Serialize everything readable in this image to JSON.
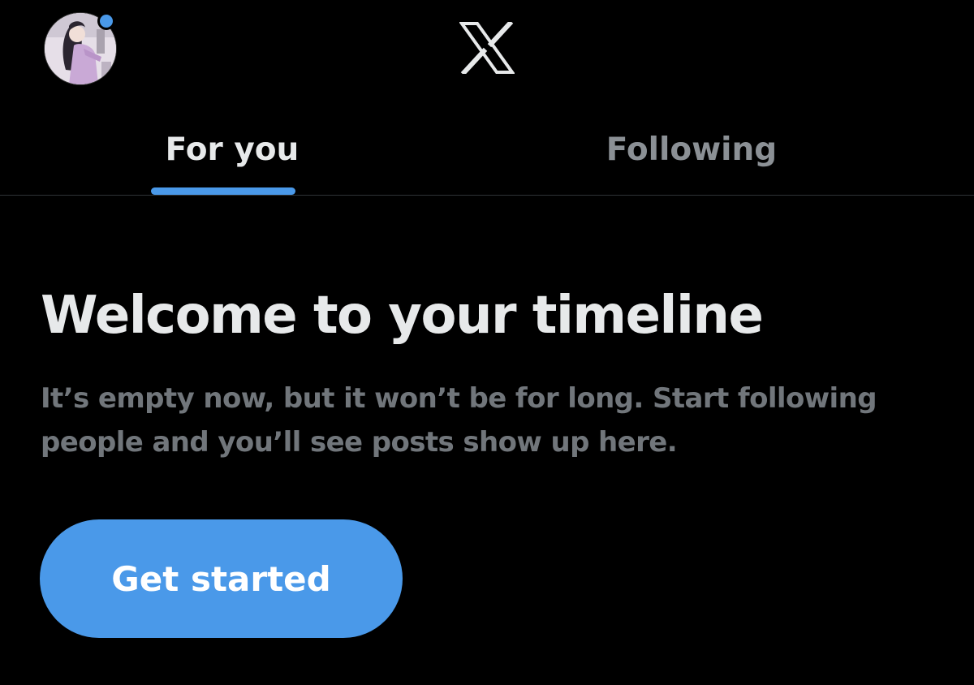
{
  "header": {
    "avatar_icon": "profile-avatar",
    "logo_icon": "x-logo-icon",
    "notification_dot_color": "#4a99e9"
  },
  "tabs": [
    {
      "label": "For you",
      "active": true
    },
    {
      "label": "Following",
      "active": false
    }
  ],
  "empty_state": {
    "title": "Welcome to your timeline",
    "description": "It’s empty now, but it won’t be for long. Start following people and you’ll see posts show up here.",
    "button_label": "Get started"
  },
  "colors": {
    "background": "#000000",
    "accent": "#4a99e9",
    "primary_text": "#e7e9ea",
    "secondary_text": "#71767b"
  }
}
